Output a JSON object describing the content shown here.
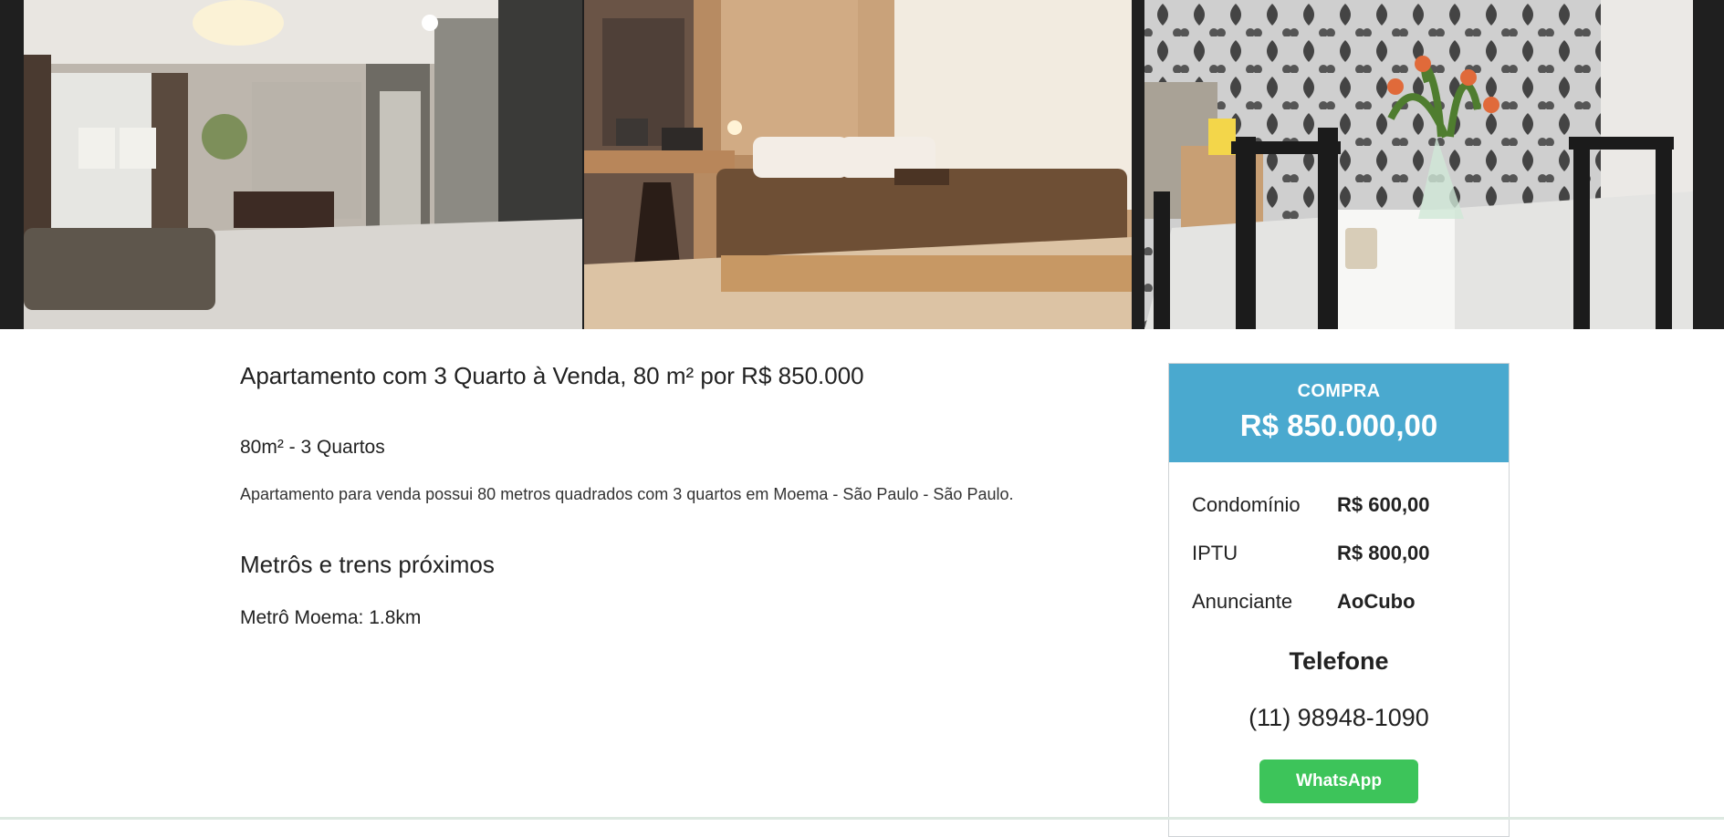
{
  "gallery": {
    "photos": [
      {
        "alt": "living-room-photo"
      },
      {
        "alt": "bedroom-photo"
      },
      {
        "alt": "dining-room-photo"
      }
    ]
  },
  "listing": {
    "title": "Apartamento com 3 Quarto à Venda, 80 m² por R$ 850.000",
    "summary": "80m² - 3 Quartos",
    "description": "Apartamento para venda possui 80 metros quadrados com 3 quartos em Moema - São Paulo - São Paulo.",
    "metro_section_title": "Metrôs e trens próximos",
    "metro_items": [
      "Metrô Moema: 1.8km"
    ]
  },
  "card": {
    "label": "COMPRA",
    "price": "R$ 850.000,00",
    "rows": [
      {
        "key": "Condomínio",
        "value": "R$ 600,00"
      },
      {
        "key": "IPTU",
        "value": "R$ 800,00"
      },
      {
        "key": "Anunciante",
        "value": "AoCubo"
      }
    ],
    "phone_title": "Telefone",
    "phone": "(11) 98948-1090",
    "whatsapp_label": "WhatsApp",
    "header_color": "#4aa9cf",
    "whatsapp_color": "#3dc45a"
  }
}
